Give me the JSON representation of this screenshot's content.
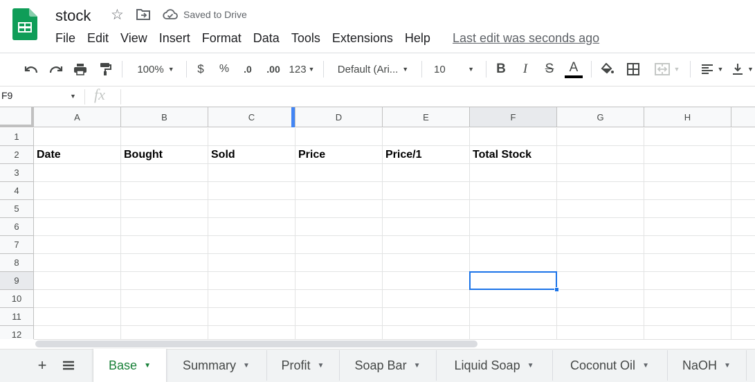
{
  "header": {
    "title": "stock",
    "saved_status": "Saved to Drive",
    "last_edit": "Last edit was seconds ago"
  },
  "menu": [
    "File",
    "Edit",
    "View",
    "Insert",
    "Format",
    "Data",
    "Tools",
    "Extensions",
    "Help"
  ],
  "toolbar": {
    "zoom": "100%",
    "currency": "$",
    "percent": "%",
    "decrease_decimal": ".0",
    "increase_decimal": ".00",
    "number_format": "123",
    "font": "Default (Ari...",
    "font_size": "10",
    "bold": "B",
    "italic": "I",
    "strikethrough": "S",
    "text_color": "A",
    "text_color_value": "#000000"
  },
  "formula_bar": {
    "name_box": "F9",
    "fx": "fx",
    "value": ""
  },
  "grid": {
    "columns": [
      "A",
      "B",
      "C",
      "D",
      "E",
      "F",
      "G",
      "H"
    ],
    "rows": [
      "1",
      "2",
      "3",
      "4",
      "5",
      "6",
      "7",
      "8",
      "9",
      "10",
      "11",
      "12"
    ],
    "row2": [
      "Date",
      "Bought",
      "Sold",
      "Price",
      "Price/1",
      "Total Stock",
      "",
      ""
    ],
    "selected_cell": "F9"
  },
  "sheets": {
    "add_label": "+",
    "tabs": [
      "Base",
      "Summary",
      "Profit",
      "Soap Bar",
      "Liquid Soap",
      "Coconut Oil",
      "NaOH"
    ],
    "active": "Base"
  },
  "colors": {
    "accent": "#1a73e8",
    "sheets_green": "#188038",
    "active_tab_text": "#188038"
  }
}
